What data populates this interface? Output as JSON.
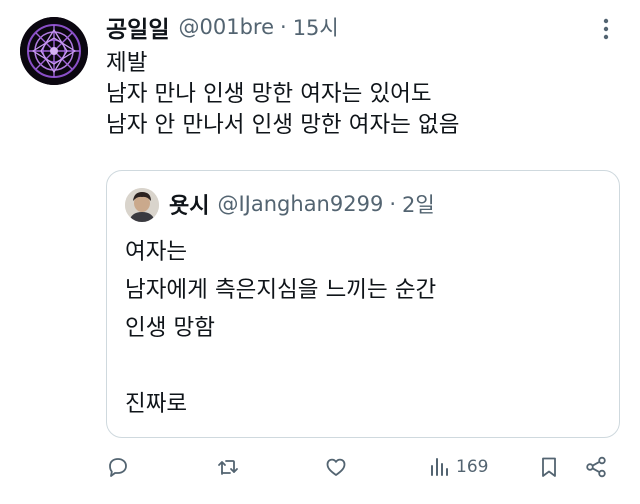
{
  "tweet": {
    "author_name": "공일일",
    "author_handle": "@001bre",
    "separator": "·",
    "time": "15시",
    "lines": [
      "제발",
      "남자 만나 인생 망한 여자는 있어도",
      "남자 안 만나서 인생 망한 여자는 없음"
    ]
  },
  "quote": {
    "author_name": "욧시",
    "author_handle": "@IJanghan9299",
    "separator": "·",
    "time": "2일",
    "lines": [
      "여자는",
      "남자에게 측은지심을 느끼는 순간",
      "인생 망함",
      "",
      "진짜로"
    ]
  },
  "actions": {
    "reply_icon": "reply-icon",
    "retweet_icon": "retweet-icon",
    "like_icon": "heart-icon",
    "views_icon": "views-icon",
    "views_count": "169",
    "bookmark_icon": "bookmark-icon",
    "share_icon": "share-icon"
  },
  "colors": {
    "text": "#0f1419",
    "secondary": "#536471",
    "border": "#cfd9de",
    "avatar_accent": "#8a4fc8"
  }
}
